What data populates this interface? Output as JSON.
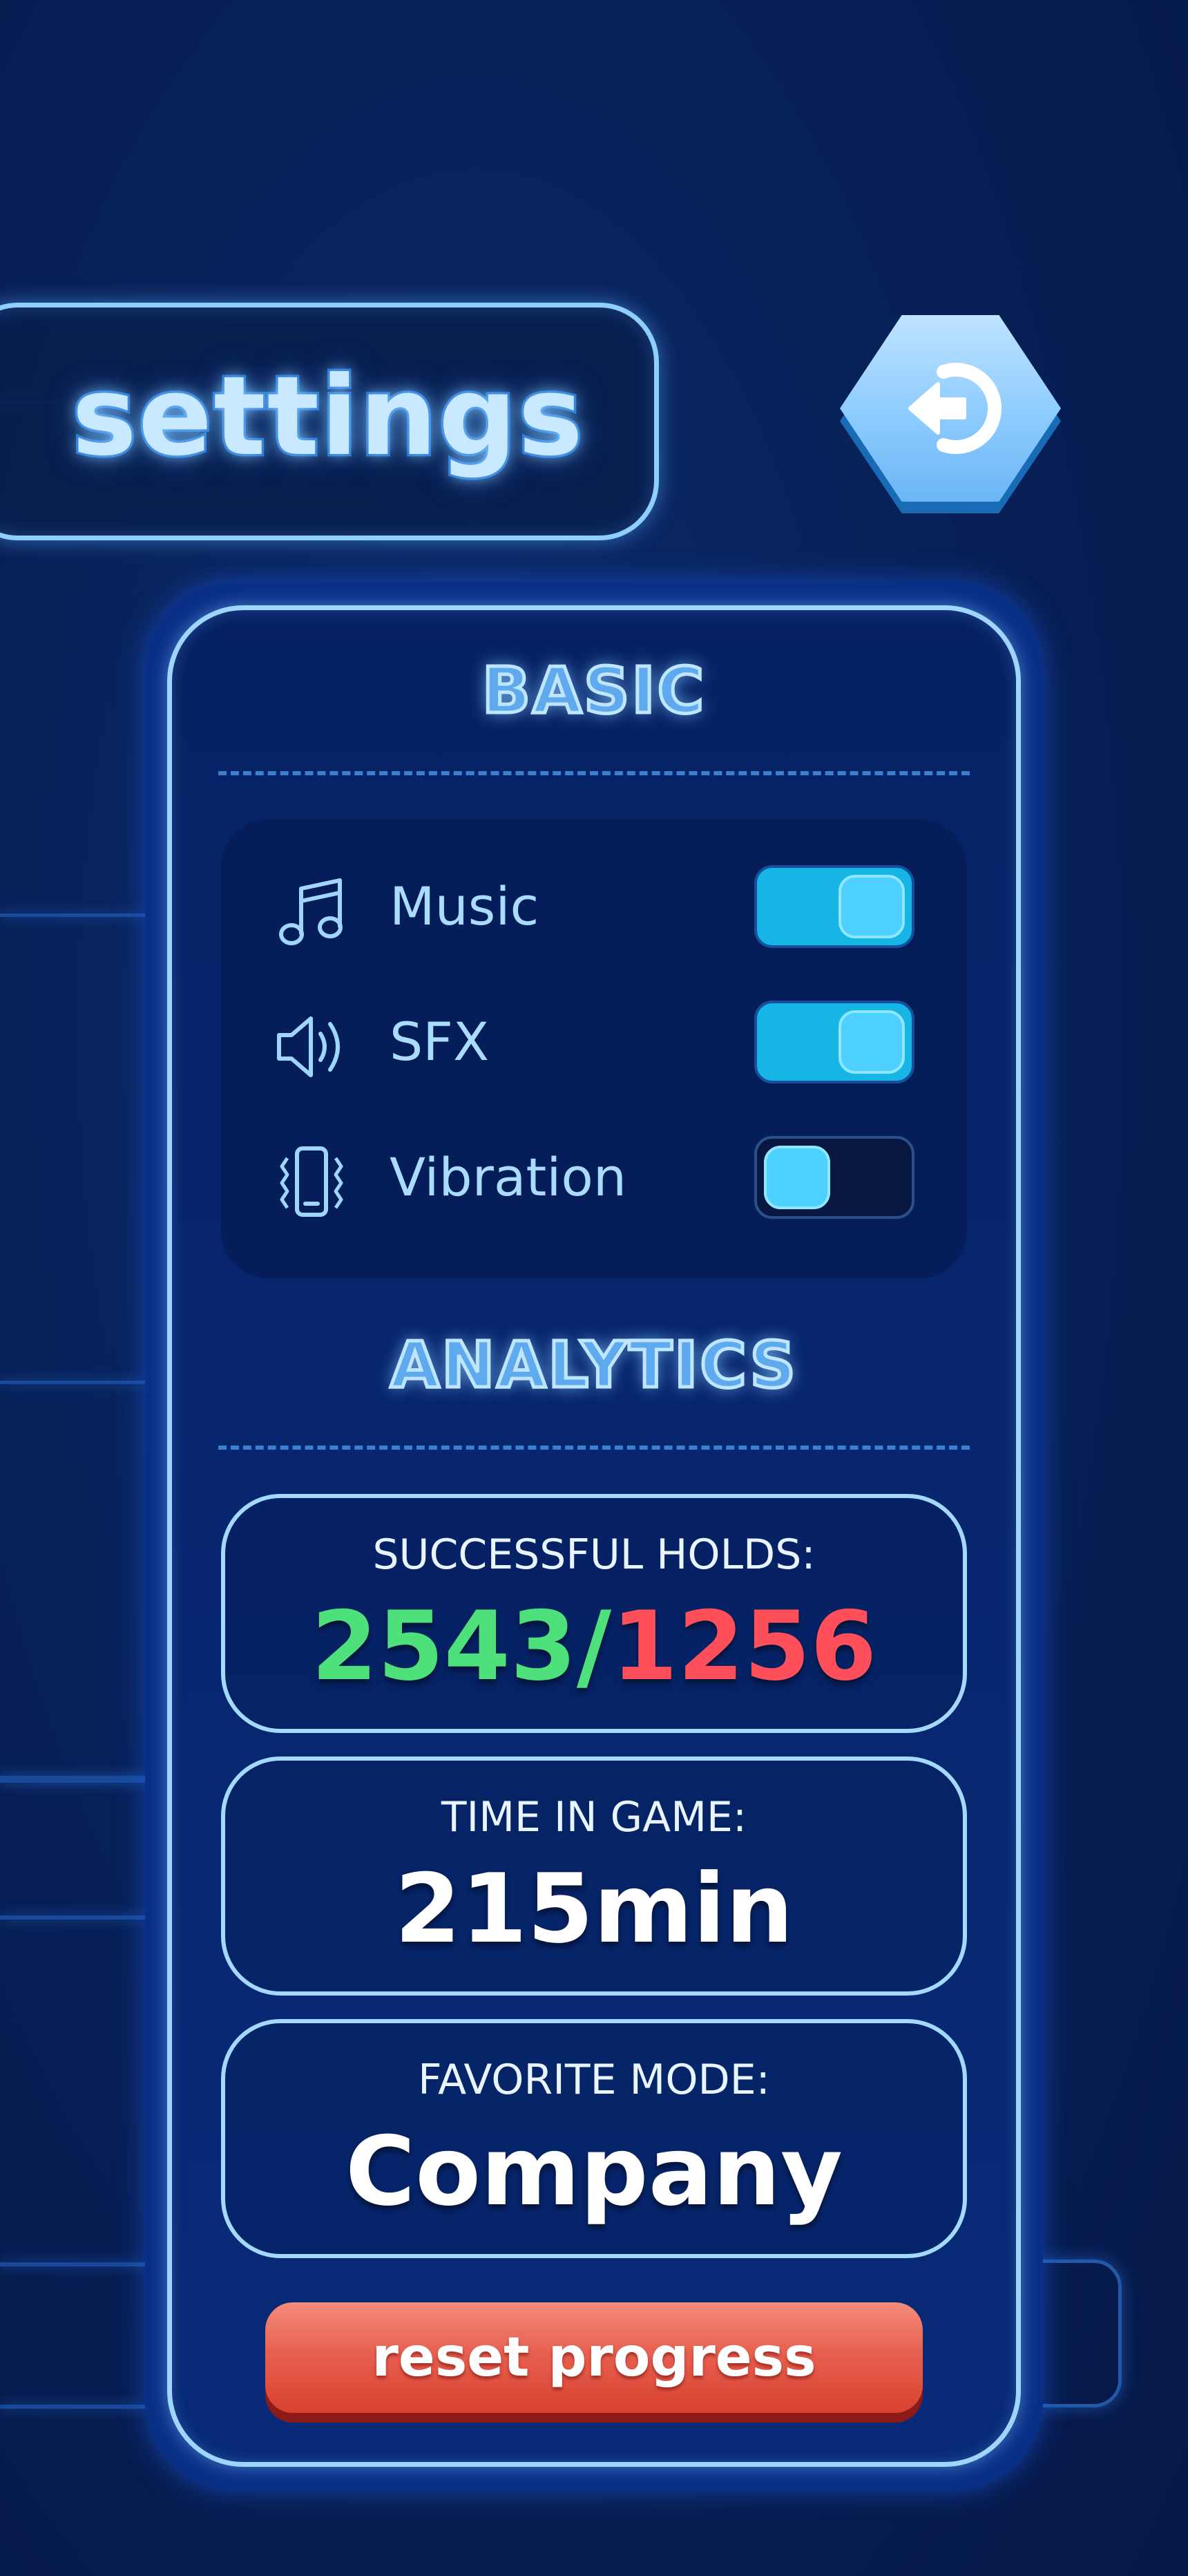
{
  "header": {
    "title": "settings",
    "back_icon": "back-arrow-icon"
  },
  "basic": {
    "title": "BASIC",
    "items": [
      {
        "label": "Music",
        "icon": "music-note-icon",
        "enabled": true
      },
      {
        "label": "SFX",
        "icon": "speaker-icon",
        "enabled": true
      },
      {
        "label": "Vibration",
        "icon": "phone-vibration-icon",
        "enabled": false
      }
    ]
  },
  "analytics": {
    "title": "ANALYTICS",
    "successful_holds": {
      "label": "SUCCESSFUL HOLDS:",
      "success": "2543",
      "separator": "/",
      "fail": "1256"
    },
    "time_in_game": {
      "label": "TIME IN GAME:",
      "value": "215min"
    },
    "favorite_mode": {
      "label": "FAVORITE MODE:",
      "value": "Company"
    }
  },
  "reset_button": {
    "label": "reset progress"
  },
  "colors": {
    "accent": "#8fcfff",
    "success": "#4ee07a",
    "fail": "#ff4f5a",
    "toggle_on": "#16b5e6",
    "reset": "#e8604f"
  }
}
